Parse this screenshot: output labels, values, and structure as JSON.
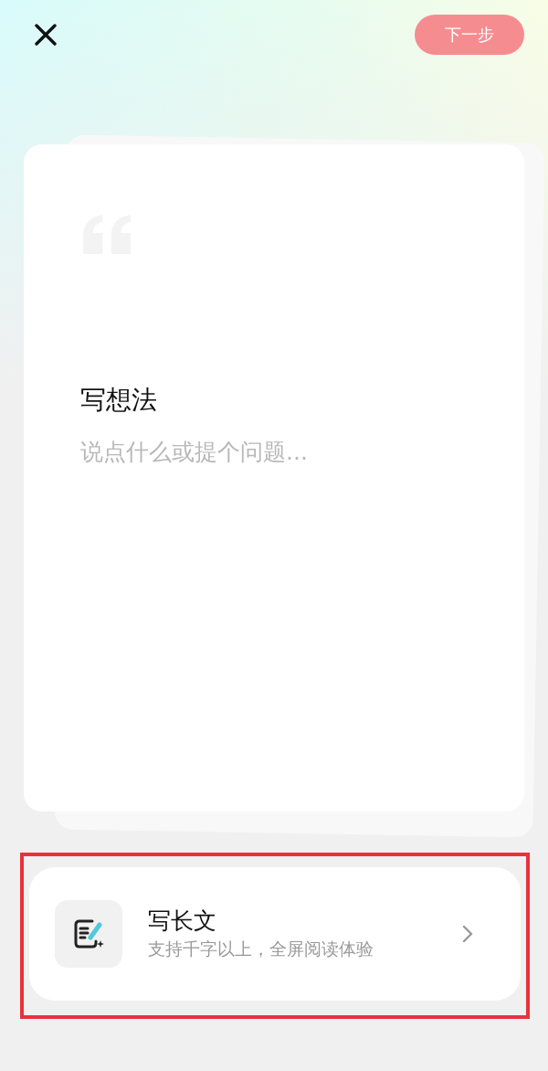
{
  "next_button": {
    "label": "下一步",
    "disabled": true
  },
  "editor": {
    "title": "写想法",
    "placeholder": "说点什么或提个问题..."
  },
  "long_article": {
    "title": "写长文",
    "subtitle": "支持千字以上，全屏阅读体验",
    "highlighted": true
  }
}
